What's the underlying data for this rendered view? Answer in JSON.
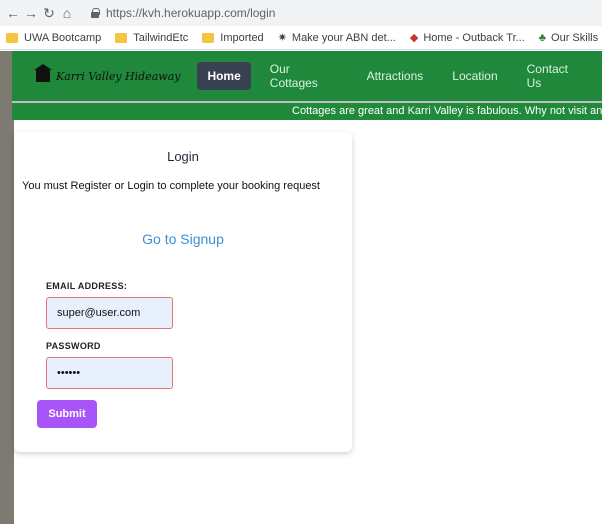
{
  "browser": {
    "url": "https://kvh.herokuapp.com/login",
    "bookmarks": [
      {
        "label": "UWA Bootcamp",
        "icon": "folder-icon"
      },
      {
        "label": "TailwindEtc",
        "icon": "folder-icon"
      },
      {
        "label": "Imported",
        "icon": "folder-icon"
      },
      {
        "label": "Make your ABN det...",
        "icon": "site-icon"
      },
      {
        "label": "Home - Outback Tr...",
        "icon": "site-icon"
      },
      {
        "label": "Our Skills | Arbor Guy",
        "icon": "site-icon"
      }
    ]
  },
  "nav": {
    "brand": "Karri Valley Hideaway",
    "items": [
      {
        "label": "Home",
        "active": true
      },
      {
        "label": "Our Cottages",
        "active": false
      },
      {
        "label": "Attractions",
        "active": false
      },
      {
        "label": "Location",
        "active": false
      },
      {
        "label": "Contact Us",
        "active": false
      }
    ]
  },
  "banner": {
    "text": "Cottages are great and Karri Valley is fabulous.  Why not visit an"
  },
  "login": {
    "title": "Login",
    "message": "You must Register or Login to complete your booking request",
    "signup_link": "Go to Signup",
    "email_label": "EMAIL ADDRESS:",
    "email_value": "super@user.com",
    "password_label": "PASSWORD",
    "password_value": "••••••",
    "submit_label": "Submit"
  },
  "colors": {
    "navbar": "#20883a",
    "active_nav": "#374151",
    "submit": "#a855f7",
    "link": "#3b8fd6",
    "input_bg": "#e8f0fe",
    "input_border": "#e57373"
  }
}
